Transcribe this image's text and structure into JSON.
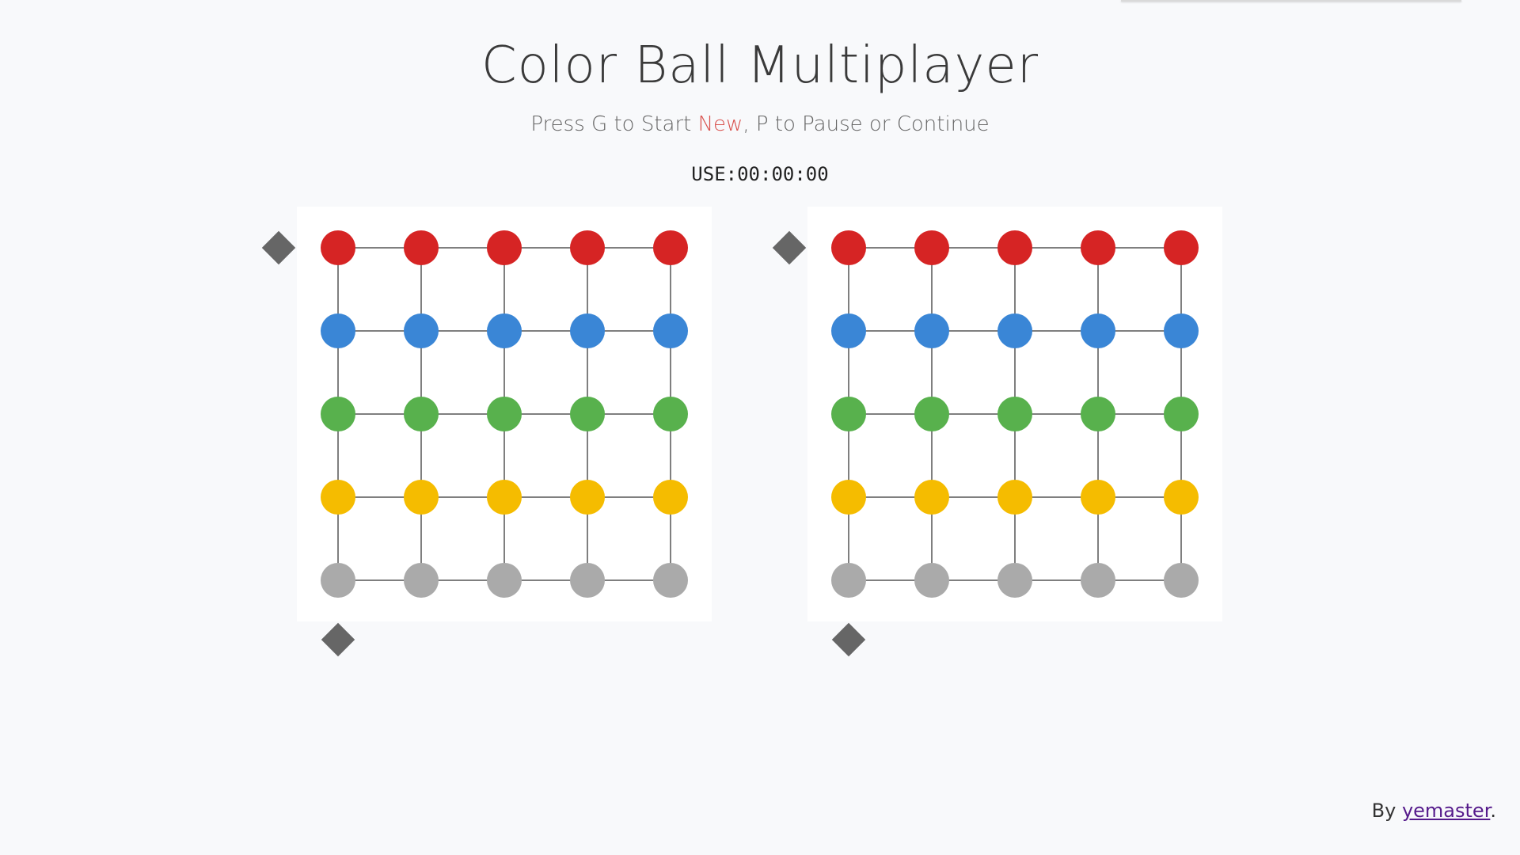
{
  "title": "Color Ball Multiplayer",
  "subtitle": {
    "part1": "Press G to Start ",
    "new_word": "New",
    "part2": ", P to Pause or Continue"
  },
  "timer": "USE:00:00:00",
  "footer": {
    "by": "By ",
    "author": "yemaster",
    "period": "."
  },
  "colors": {
    "red": "#d62424",
    "blue": "#3a86d6",
    "green": "#58b14d",
    "yellow": "#f5bc00",
    "gray": "#aaaaaa",
    "line": "#555555",
    "marker": "#666666"
  },
  "boards": [
    {
      "name": "player-1",
      "rows": [
        [
          "red",
          "red",
          "red",
          "red",
          "red"
        ],
        [
          "blue",
          "blue",
          "blue",
          "blue",
          "blue"
        ],
        [
          "green",
          "green",
          "green",
          "green",
          "green"
        ],
        [
          "yellow",
          "yellow",
          "yellow",
          "yellow",
          "yellow"
        ],
        [
          "gray",
          "gray",
          "gray",
          "gray",
          "gray"
        ]
      ]
    },
    {
      "name": "player-2",
      "rows": [
        [
          "red",
          "red",
          "red",
          "red",
          "red"
        ],
        [
          "blue",
          "blue",
          "blue",
          "blue",
          "blue"
        ],
        [
          "green",
          "green",
          "green",
          "green",
          "green"
        ],
        [
          "yellow",
          "yellow",
          "yellow",
          "yellow",
          "yellow"
        ],
        [
          "gray",
          "gray",
          "gray",
          "gray",
          "gray"
        ]
      ]
    }
  ]
}
